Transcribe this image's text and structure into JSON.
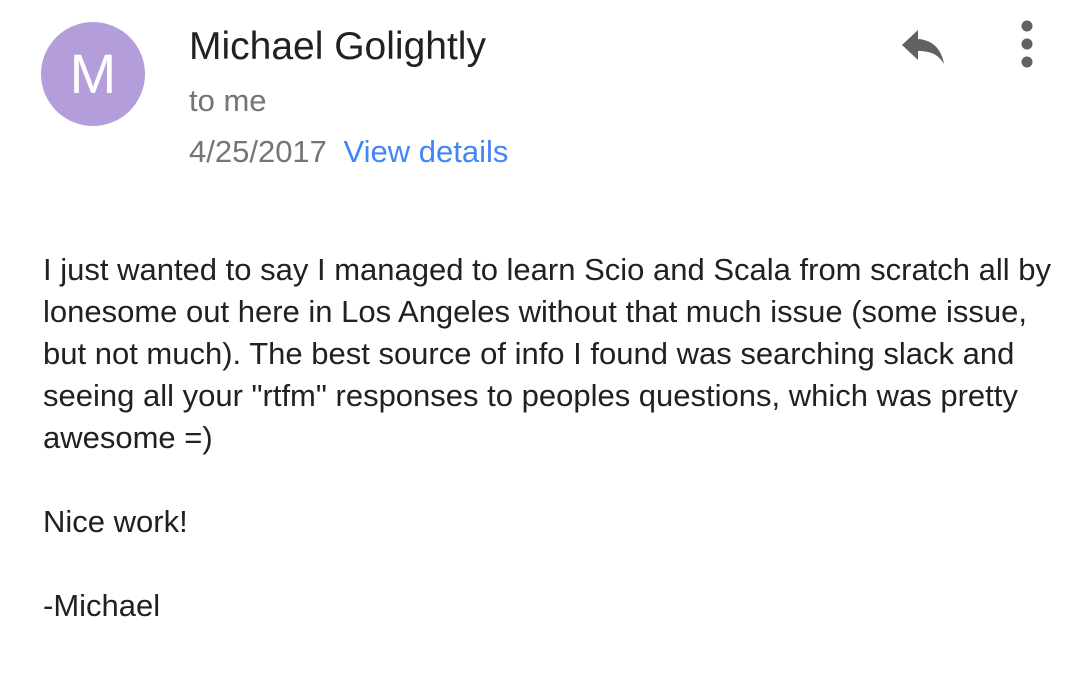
{
  "colors": {
    "avatar_bg": "#b39ddb",
    "link": "#4285f4",
    "secondary_text": "#757575",
    "primary_text": "#212121",
    "icon": "#616161"
  },
  "header": {
    "avatar_initial": "M",
    "sender_name": "Michael Golightly",
    "recipient": "to me",
    "date": "4/25/2017",
    "view_details_label": "View details",
    "reply_icon": "reply-icon",
    "more_icon": "more-vert-icon"
  },
  "message": {
    "paragraph_1": "I just wanted to say I managed to learn Scio and Scala from scratch all by lonesome out here in Los Angeles without that much issue (some issue, but not much). The best source of info I found was searching slack and seeing all your \"rtfm\" responses to peoples questions, which was pretty awesome =)",
    "paragraph_2": "Nice work!",
    "signature": "-Michael"
  }
}
